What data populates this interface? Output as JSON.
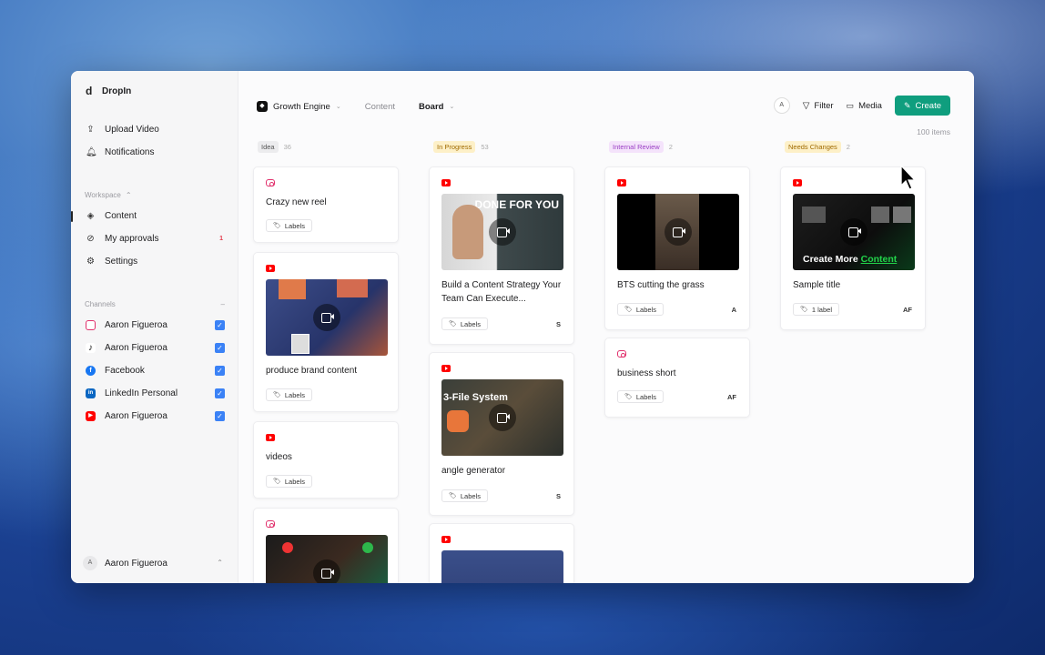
{
  "sidebar": {
    "app_name": "DropIn",
    "upload": "Upload Video",
    "notifications": "Notifications",
    "workspace_label": "Workspace",
    "content": "Content",
    "approvals": "My approvals",
    "approvals_badge": "1",
    "settings": "Settings",
    "channels_label": "Channels",
    "channels": [
      {
        "name": "Aaron Figueroa",
        "platform": "instagram"
      },
      {
        "name": "Aaron Figueroa",
        "platform": "tiktok"
      },
      {
        "name": "Facebook",
        "platform": "facebook"
      },
      {
        "name": "LinkedIn Personal",
        "platform": "linkedin"
      },
      {
        "name": "Aaron Figueroa",
        "platform": "youtube"
      }
    ],
    "user_name": "Aaron Figueroa",
    "user_initial": "A"
  },
  "header": {
    "workspace": "Growth Engine",
    "section": "Content",
    "view": "Board",
    "avatar_initial": "A",
    "filter": "Filter",
    "media": "Media",
    "create": "Create",
    "items_count": "100 items"
  },
  "columns": [
    {
      "name": "Idea",
      "count": "36",
      "color": "#ececee",
      "text_color": "#555"
    },
    {
      "name": "In Progress",
      "count": "53",
      "color": "#fdf0c8",
      "text_color": "#a06a00"
    },
    {
      "name": "Internal Review",
      "count": "2",
      "color": "#f4e3fb",
      "text_color": "#9a3fc4"
    },
    {
      "name": "Needs Changes",
      "count": "2",
      "color": "#fdf0c8",
      "text_color": "#a06a00"
    }
  ],
  "cards": {
    "idea_1": {
      "title": "Crazy new reel",
      "label": "Labels",
      "platform": "instagram"
    },
    "idea_2": {
      "title": "produce brand content",
      "label": "Labels",
      "platform": "youtube"
    },
    "idea_3": {
      "title": "videos",
      "label": "Labels",
      "platform": "youtube"
    },
    "idea_4": {
      "platform": "instagram"
    },
    "prog_1": {
      "title": "Build a Content Strategy Your Team Can Execute...",
      "label": "Labels",
      "assignee": "S",
      "thumb_text": "DONE FOR YOU",
      "platform": "youtube"
    },
    "prog_2": {
      "title": "angle generator",
      "label": "Labels",
      "assignee": "S",
      "thumb_text": "3-File System",
      "platform": "youtube"
    },
    "prog_3": {
      "platform": "youtube"
    },
    "rev_1": {
      "title": "BTS cutting the grass",
      "label": "Labels",
      "assignee": "A",
      "platform": "youtube"
    },
    "rev_2": {
      "title": "business short",
      "label": "Labels",
      "assignee": "AF",
      "platform": "instagram"
    },
    "chg_1": {
      "title": "Sample title",
      "label": "1 label",
      "assignee": "AF",
      "thumb_text_a": "Create More",
      "thumb_text_b": "Content",
      "platform": "youtube"
    }
  }
}
